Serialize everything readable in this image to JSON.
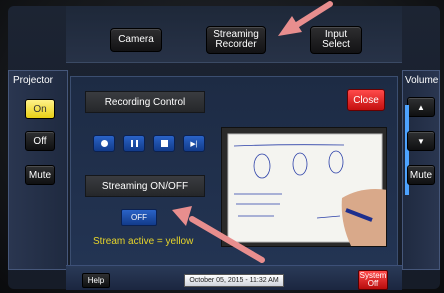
{
  "top_bar": {
    "camera_label": "Camera",
    "streaming_recorder_label": "Streaming Recorder",
    "input_select_label": "Input Select"
  },
  "projector": {
    "title": "Projector",
    "on_label": "On",
    "off_label": "Off",
    "mute_label": "Mute",
    "active": "On"
  },
  "volume": {
    "title": "Volume",
    "mute_label": "Mute"
  },
  "recording": {
    "title": "Recording Control",
    "close_label": "Close",
    "controls": [
      "record-icon",
      "pause-icon",
      "stop-icon",
      "next-icon"
    ]
  },
  "streaming": {
    "title": "Streaming ON/OFF",
    "toggle_label": "OFF",
    "hint": "Stream active = yellow"
  },
  "bottom_bar": {
    "help_label": "Help",
    "datetime": "October 05, 2015  -  11:32 AM",
    "system_off_label": "System Off"
  },
  "colors": {
    "accent_yellow": "#e8cf15",
    "close_red": "#e01a1a",
    "control_blue": "#1f4fae",
    "annotation_arrow": "#e88e8e"
  }
}
